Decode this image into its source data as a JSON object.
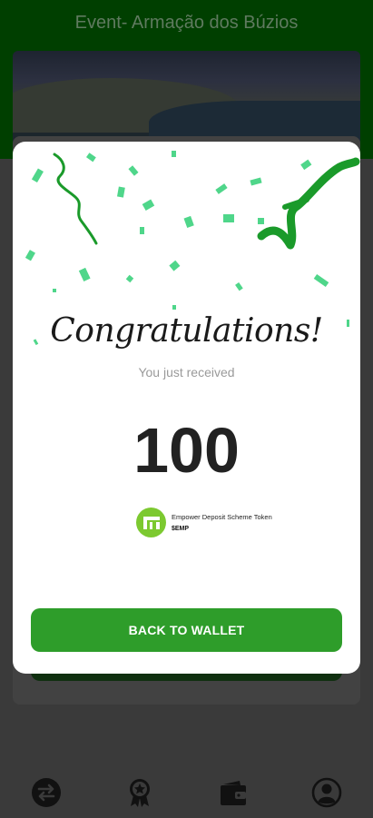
{
  "app": {
    "title": "Event- Armação dos Búzios"
  },
  "bottom_nav": {
    "items": [
      {
        "icon": "swap-arrows-icon"
      },
      {
        "icon": "award-badge-icon"
      },
      {
        "icon": "wallet-icon"
      },
      {
        "icon": "profile-icon"
      }
    ]
  },
  "modal": {
    "heading": "Congratulations!",
    "subtitle": "You just received",
    "amount": "100",
    "token": {
      "name": "Empower Deposit Scheme Token",
      "symbol": "$EMP",
      "icon": "empower-logo-icon"
    },
    "button_label": "BACK TO WALLET"
  },
  "colors": {
    "accent": "#2e9d2a",
    "confetti": "#4fd68a",
    "ribbon": "#1a9a2a",
    "token_logo": "#7cc930"
  }
}
